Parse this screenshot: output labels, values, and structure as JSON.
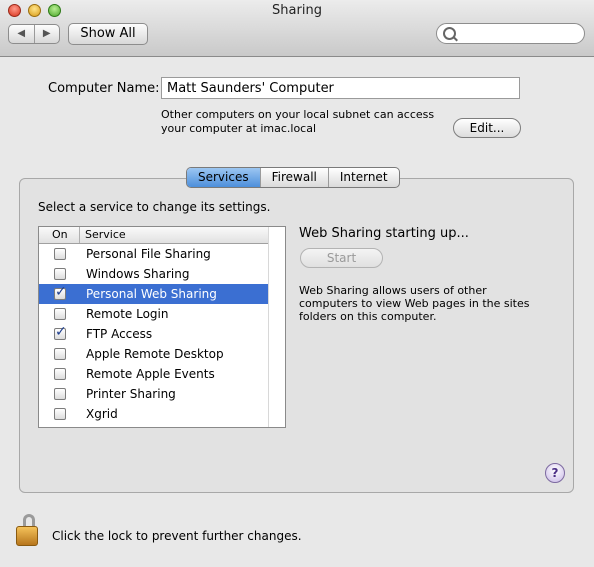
{
  "window": {
    "title": "Sharing"
  },
  "toolbar": {
    "back_glyph": "◀",
    "forward_glyph": "▶",
    "show_all_label": "Show All",
    "search_value": "",
    "search_placeholder": ""
  },
  "computer_name": {
    "label": "Computer Name:",
    "value": "Matt Saunders' Computer",
    "description_line1": "Other computers on your local subnet can access",
    "description_line2": "your computer at imac.local",
    "edit_label": "Edit..."
  },
  "tabs": [
    {
      "label": "Services",
      "active": true
    },
    {
      "label": "Firewall",
      "active": false
    },
    {
      "label": "Internet",
      "active": false
    }
  ],
  "services": {
    "instruction": "Select a service to change its settings.",
    "col_on": "On",
    "col_service": "Service",
    "items": [
      {
        "name": "Personal File Sharing",
        "on": false,
        "selected": false
      },
      {
        "name": "Windows Sharing",
        "on": false,
        "selected": false
      },
      {
        "name": "Personal Web Sharing",
        "on": true,
        "selected": true
      },
      {
        "name": "Remote Login",
        "on": false,
        "selected": false
      },
      {
        "name": "FTP Access",
        "on": true,
        "selected": false
      },
      {
        "name": "Apple Remote Desktop",
        "on": false,
        "selected": false
      },
      {
        "name": "Remote Apple Events",
        "on": false,
        "selected": false
      },
      {
        "name": "Printer Sharing",
        "on": false,
        "selected": false
      },
      {
        "name": "Xgrid",
        "on": false,
        "selected": false
      }
    ]
  },
  "detail": {
    "status": "Web Sharing starting up...",
    "start_label": "Start",
    "description_line1": "Web Sharing allows users of other",
    "description_line2": "computers to view Web pages in the sites",
    "description_line3": "folders on this computer."
  },
  "help_glyph": "?",
  "lock": {
    "text": "Click the lock to prevent further changes."
  },
  "colors": {
    "selection": "#3b6fd2",
    "active_tab": "#4d8fdb"
  }
}
